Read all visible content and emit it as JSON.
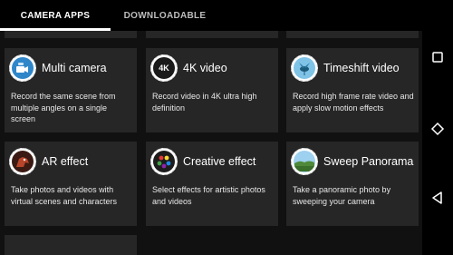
{
  "tabs": {
    "camera_apps": "CAMERA APPS",
    "downloadable": "DOWNLOADABLE"
  },
  "cards": [
    {
      "title": "Multi camera",
      "desc": "Record the same scene from multiple angles on a single screen",
      "icon": "multi-camera-icon"
    },
    {
      "title": "4K video",
      "desc": "Record video in 4K ultra high definition",
      "icon": "4k-video-icon",
      "badge": "4K"
    },
    {
      "title": "Timeshift video",
      "desc": "Record high frame rate video and apply slow motion effects",
      "icon": "timeshift-video-icon"
    },
    {
      "title": "AR effect",
      "desc": "Take photos and videos with virtual scenes and characters",
      "icon": "ar-effect-icon"
    },
    {
      "title": "Creative effect",
      "desc": "Select effects for artistic photos and videos",
      "icon": "creative-effect-icon"
    },
    {
      "title": "Sweep Panorama",
      "desc": "Take a panoramic photo by sweeping your camera",
      "icon": "sweep-panorama-icon"
    }
  ],
  "colors": {
    "background": "#111111",
    "card": "#262626",
    "tab_active": "#ffffff",
    "tab_inactive": "#bdbdbd"
  },
  "nav": {
    "recent": "recent-apps-icon",
    "home": "home-icon",
    "back": "back-icon"
  }
}
